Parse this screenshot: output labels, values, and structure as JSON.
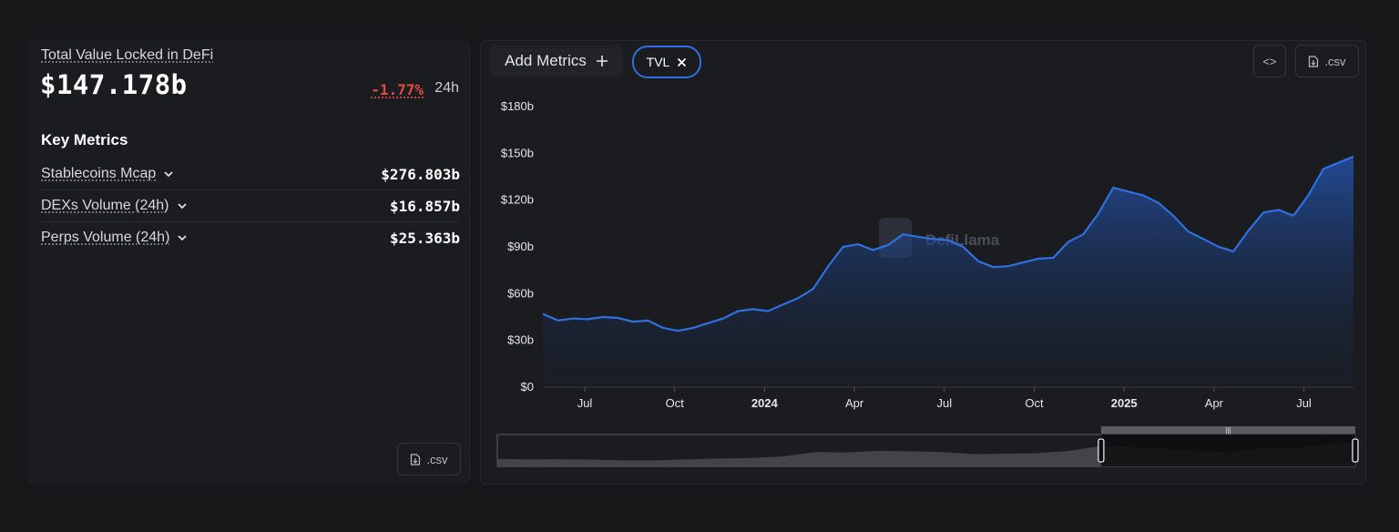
{
  "summary": {
    "tvl_label": "Total Value Locked in DeFi",
    "tvl_value": "$147.178b",
    "change_24h": "-1.77%",
    "change_period": "24h"
  },
  "key_metrics": {
    "title": "Key Metrics",
    "items": [
      {
        "label": "Stablecoins Mcap",
        "value": "$276.803b"
      },
      {
        "label": "DEXs Volume (24h)",
        "value": "$16.857b"
      },
      {
        "label": "Perps Volume (24h)",
        "value": "$25.363b"
      }
    ]
  },
  "toolbar": {
    "add_metrics_label": "Add Metrics",
    "tvl_chip_label": "TVL",
    "embed_label": "<>",
    "csv_label": ".csv"
  },
  "left_csv_label": ".csv",
  "watermark": "DefiLlama",
  "colors": {
    "accent": "#2f6fe0",
    "negative": "#e54a40",
    "line": "#2f6fe0"
  },
  "chart_data": {
    "type": "area",
    "series": [
      {
        "name": "TVL"
      }
    ],
    "y_ticks": [
      "$0",
      "$30b",
      "$60b",
      "$90b",
      "$120b",
      "$150b",
      "$180b"
    ],
    "x_ticks": [
      "Jul",
      "Oct",
      "2024",
      "Apr",
      "Jul",
      "Oct",
      "2025",
      "Apr",
      "Jul"
    ],
    "x_ticks_bold": [
      "2024",
      "2025"
    ],
    "ylim": [
      0,
      180
    ],
    "unit": "b",
    "x": [
      "2023-05",
      "2023-06",
      "2023-07",
      "2023-08",
      "2023-09",
      "2023-10",
      "2023-11",
      "2023-12",
      "2024-01",
      "2024-02",
      "2024-03",
      "2024-04",
      "2024-05",
      "2024-06",
      "2024-07",
      "2024-08",
      "2024-09",
      "2024-10",
      "2024-11",
      "2024-12",
      "2025-01",
      "2025-02",
      "2025-03",
      "2025-04",
      "2025-05",
      "2025-06",
      "2025-07",
      "2025-08"
    ],
    "values": [
      47,
      44,
      45,
      42,
      38,
      38,
      44,
      50,
      53,
      63,
      90,
      88,
      98,
      95,
      90,
      77,
      80,
      83,
      98,
      128,
      123,
      110,
      95,
      87,
      112,
      110,
      140,
      148
    ],
    "range_selector": {
      "from": "2024-12",
      "to": "2025-08"
    }
  }
}
